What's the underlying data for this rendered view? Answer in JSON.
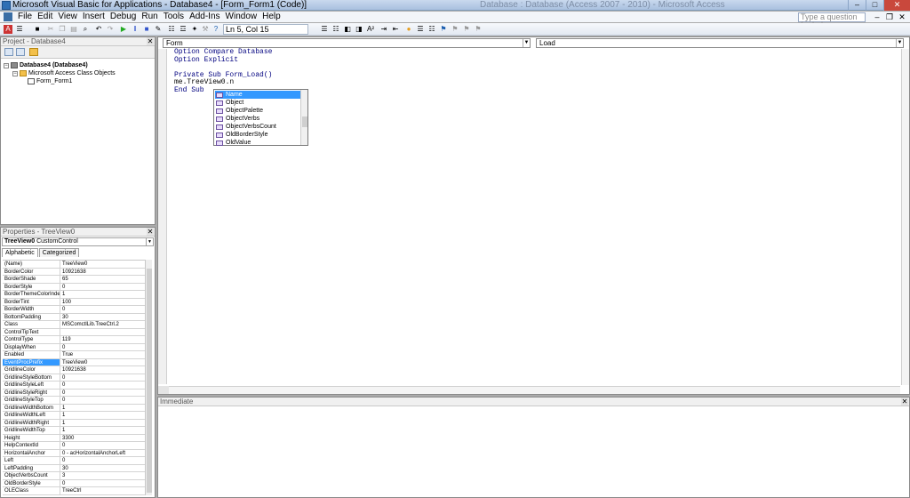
{
  "window": {
    "title": "Microsoft Visual Basic for Applications - Database4 - [Form_Form1 (Code)]",
    "background_title": "Database : Database (Access 2007 - 2010) - Microsoft Access"
  },
  "menu": {
    "items": [
      "File",
      "Edit",
      "View",
      "Insert",
      "Debug",
      "Run",
      "Tools",
      "Add-Ins",
      "Window",
      "Help"
    ],
    "help_placeholder": "Type a question for help"
  },
  "toolbar": {
    "position": "Ln 5, Col 15"
  },
  "project": {
    "title": "Project - Database4",
    "tree": [
      {
        "label": "Database4 (Database4)",
        "bold": true
      },
      {
        "label": "Microsoft Access Class Objects",
        "bold": false
      },
      {
        "label": "Form_Form1",
        "bold": false
      }
    ]
  },
  "properties": {
    "title": "Properties - TreeView0",
    "object_name": "TreeView0",
    "object_type": "CustomControl",
    "tabs": [
      "Alphabetic",
      "Categorized"
    ],
    "rows": [
      {
        "name": "(Name)",
        "value": "TreeView0"
      },
      {
        "name": "BorderColor",
        "value": "10921638"
      },
      {
        "name": "BorderShade",
        "value": "65"
      },
      {
        "name": "BorderStyle",
        "value": "0"
      },
      {
        "name": "BorderThemeColorIndex",
        "value": "1"
      },
      {
        "name": "BorderTint",
        "value": "100"
      },
      {
        "name": "BorderWidth",
        "value": "0"
      },
      {
        "name": "BottomPadding",
        "value": "30"
      },
      {
        "name": "Class",
        "value": "MSComctlLib.TreeCtrl.2"
      },
      {
        "name": "ControlTipText",
        "value": ""
      },
      {
        "name": "ControlType",
        "value": "119"
      },
      {
        "name": "DisplayWhen",
        "value": "0"
      },
      {
        "name": "Enabled",
        "value": "True"
      },
      {
        "name": "EventProcPrefix",
        "value": "TreeView0"
      },
      {
        "name": "GridlineColor",
        "value": "10921638"
      },
      {
        "name": "GridlineStyleBottom",
        "value": "0"
      },
      {
        "name": "GridlineStyleLeft",
        "value": "0"
      },
      {
        "name": "GridlineStyleRight",
        "value": "0"
      },
      {
        "name": "GridlineStyleTop",
        "value": "0"
      },
      {
        "name": "GridlineWidthBottom",
        "value": "1"
      },
      {
        "name": "GridlineWidthLeft",
        "value": "1"
      },
      {
        "name": "GridlineWidthRight",
        "value": "1"
      },
      {
        "name": "GridlineWidthTop",
        "value": "1"
      },
      {
        "name": "Height",
        "value": "3300"
      },
      {
        "name": "HelpContextId",
        "value": "0"
      },
      {
        "name": "HorizontalAnchor",
        "value": "0 - acHorizontalAnchorLeft"
      },
      {
        "name": "Left",
        "value": "0"
      },
      {
        "name": "LeftPadding",
        "value": "30"
      },
      {
        "name": "ObjectVerbsCount",
        "value": "3"
      },
      {
        "name": "OldBorderStyle",
        "value": "0"
      },
      {
        "name": "OLEClass",
        "value": "TreeCtrl"
      }
    ],
    "selected_row": "EventProcPrefix"
  },
  "code": {
    "object_combo": "Form",
    "procedure_combo": "Load",
    "lines": [
      {
        "text": "Option Compare Database",
        "kw": true
      },
      {
        "text": "Option Explicit",
        "kw": true
      },
      {
        "text": "",
        "kw": false
      },
      {
        "text": "Private Sub Form_Load()",
        "kw": true
      },
      {
        "text": "me.TreeView0.n",
        "kw": false
      },
      {
        "text": "End Sub",
        "kw": true
      }
    ]
  },
  "autocomplete": {
    "items": [
      "Name",
      "Object",
      "ObjectPalette",
      "ObjectVerbs",
      "ObjectVerbsCount",
      "OldBorderStyle",
      "OldValue"
    ],
    "selected": "Name"
  },
  "immediate": {
    "title": "Immediate"
  }
}
